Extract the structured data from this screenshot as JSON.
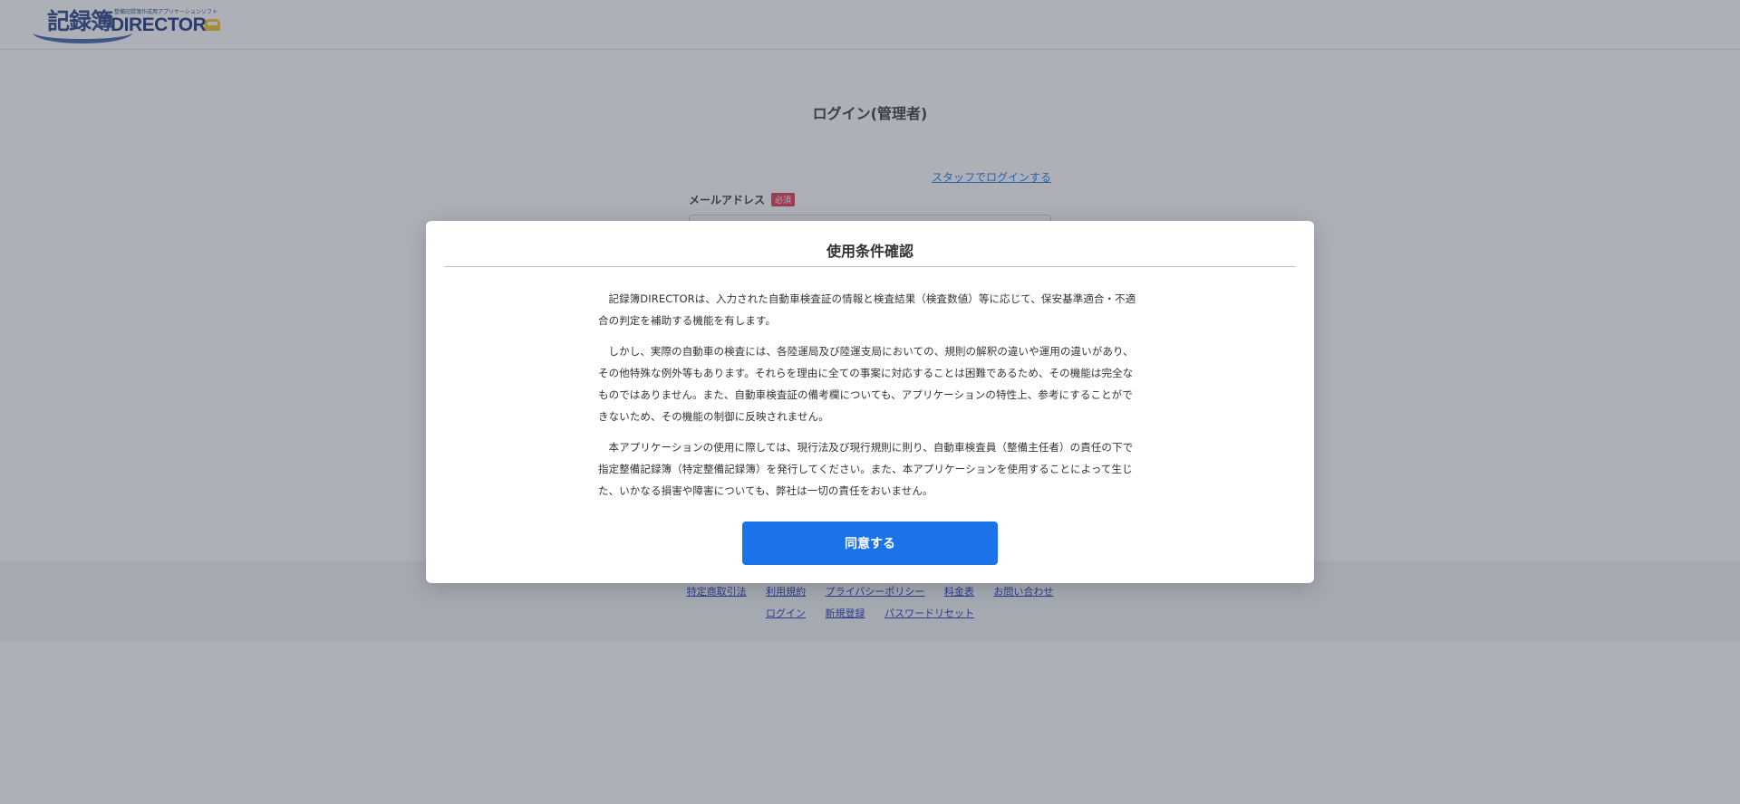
{
  "header": {
    "logo": {
      "kanji": "記録簿",
      "subtitle": "整備記録簿作成用アプリケーションソフト",
      "product": "DIRECTOR"
    }
  },
  "login": {
    "title": "ログイン(管理者)",
    "staff_link": "スタッフでログインする",
    "email_label": "メールアドレス",
    "required_badge": "必須"
  },
  "footer": {
    "row1": [
      "特定商取引法",
      "利用規約",
      "プライバシーポリシー",
      "料金表",
      "お問い合わせ"
    ],
    "row2": [
      "ログイン",
      "新規登録",
      "パスワードリセット"
    ]
  },
  "modal": {
    "title": "使用条件確認",
    "paragraphs": [
      "記録簿DIRECTORは、入力された自動車検査証の情報と検査結果（検査数値）等に応じて、保安基準適合・不適合の判定を補助する機能を有します。",
      "しかし、実際の自動車の検査には、各陸運局及び陸運支局においての、規則の解釈の違いや運用の違いがあり、その他特殊な例外等もあります。それらを理由に全ての事案に対応することは困難であるため、その機能は完全なものではありません。また、自動車検査証の備考欄についても、アプリケーションの特性上、参考にすることができないため、その機能の制御に反映されません。",
      "本アプリケーションの使用に際しては、現行法及び現行規則に則り、自動車検査員（整備主任者）の責任の下で指定整備記録簿（特定整備記録簿）を発行してください。また、本アプリケーションを使用することによって生じた、いかなる損害や障害についても、弊社は一切の責任をおいません。"
    ],
    "agree_label": "同意する"
  },
  "colors": {
    "primary": "#1a73e8",
    "required": "#e0334a",
    "footer_link": "#1b2fb5",
    "overlay": "rgba(69,74,90,0.44)"
  }
}
